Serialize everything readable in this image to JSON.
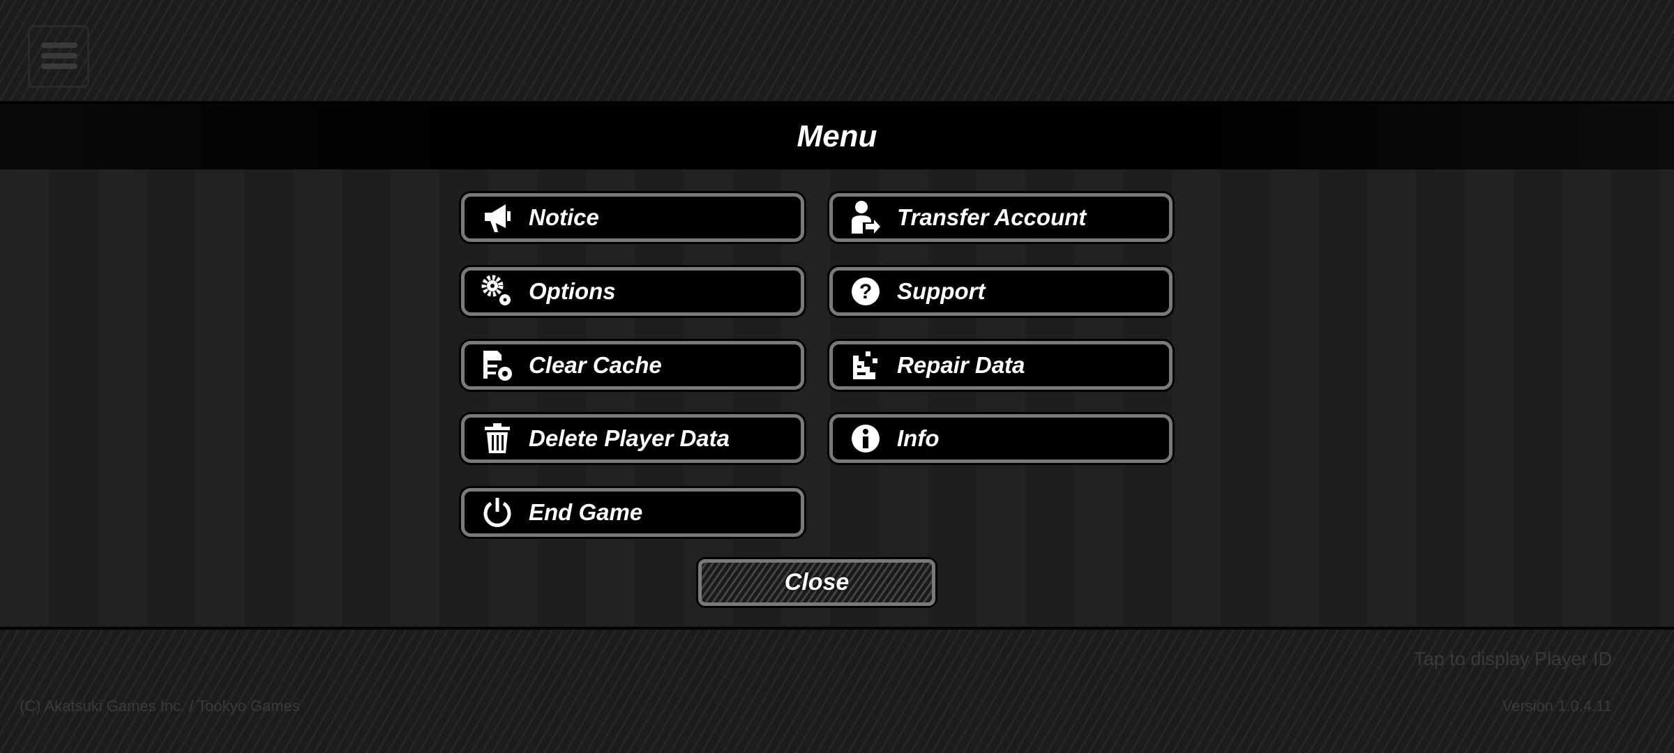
{
  "header": {
    "title": "Menu"
  },
  "buttons": [
    {
      "label": "Notice",
      "icon": "megaphone-icon"
    },
    {
      "label": "Transfer Account",
      "icon": "user-transfer-icon"
    },
    {
      "label": "Options",
      "icon": "gears-icon"
    },
    {
      "label": "Support",
      "icon": "question-circle-icon"
    },
    {
      "label": "Clear Cache",
      "icon": "clear-cache-icon"
    },
    {
      "label": "Repair Data",
      "icon": "repair-data-icon"
    },
    {
      "label": "Delete Player Data",
      "icon": "trash-icon"
    },
    {
      "label": "Info",
      "icon": "info-circle-icon"
    },
    {
      "label": "End Game",
      "icon": "power-icon"
    }
  ],
  "close_label": "Close",
  "footer": {
    "player_id": "Tap to display Player ID",
    "copyright": "(C) Akatsuki Games Inc. / Tookyo Games",
    "version": "Version 1.0.4.11"
  }
}
